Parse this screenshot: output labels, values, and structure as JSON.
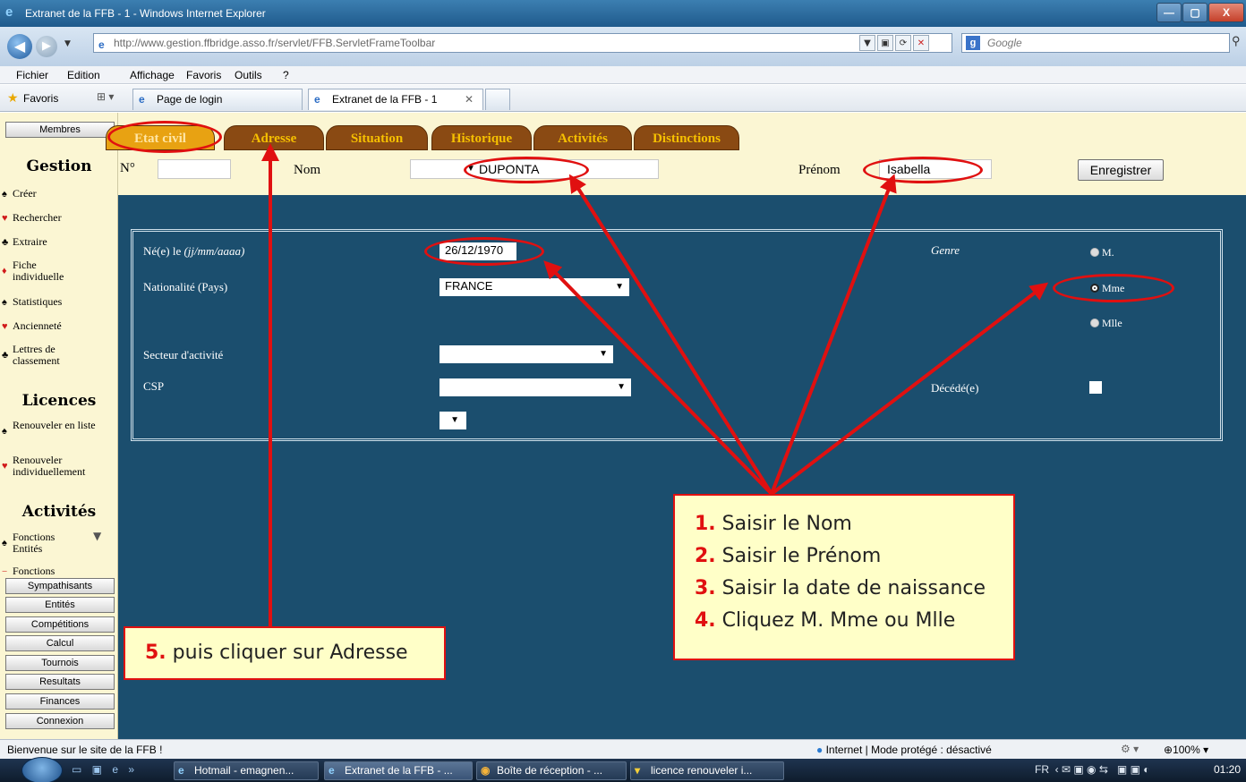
{
  "window": {
    "title": "Extranet de la FFB - 1 - Windows Internet Explorer",
    "url": "http://www.gestion.ffbridge.asso.fr/servlet/FFB.ServletFrameToolbar",
    "search_placeholder": "Google"
  },
  "menu": [
    "Fichier",
    "Edition",
    "Affichage",
    "Favoris",
    "Outils",
    "?"
  ],
  "favorites": {
    "label": "Favoris",
    "tabs": [
      "Page de login",
      "Extranet de la FFB - 1"
    ]
  },
  "sidebar": {
    "membres": "Membres",
    "gestion_title": "Gestion",
    "gestion_items": [
      "Créer",
      "Rechercher",
      "Extraire",
      "Fiche individuelle",
      "Statistiques",
      "Ancienneté",
      "Lettres de classement"
    ],
    "licences_title": "Licences",
    "licences_items": [
      "Renouveler en liste",
      "Renouveler individuellement"
    ],
    "activites_title": "Activités",
    "activites_items": [
      "Fonctions Entités",
      "Fonctions"
    ],
    "buttons": [
      "Sympathisants",
      "Entités",
      "Compétitions",
      "Calcul",
      "Tournois",
      "Resultats",
      "Finances",
      "Connexion"
    ]
  },
  "tabs": [
    "Etat civil",
    "Adresse",
    "Situation",
    "Historique",
    "Activités",
    "Distinctions"
  ],
  "header_form": {
    "num_label": "N°",
    "num_value": "",
    "nom_label": "Nom",
    "nom_value": "DUPONTA",
    "prenom_label": "Prénom",
    "prenom_value": "Isabella",
    "save_button": "Enregistrer"
  },
  "panel": {
    "birth_label": "Né(e) le",
    "birth_format": "(jj/mm/aaaa)",
    "birth_value": "26/12/1970",
    "nationality_label": "Nationalité (Pays)",
    "nationality_value": "FRANCE",
    "sector_label": "Secteur d'activité",
    "csp_label": "CSP",
    "genre_label": "Genre",
    "genre_options": [
      "M.",
      "Mme",
      "Mlle"
    ],
    "genre_selected": "Mme",
    "deceased_label": "Décédé(e)"
  },
  "annotations": {
    "steps": [
      {
        "num": "1.",
        "text": "Saisir le Nom"
      },
      {
        "num": "2.",
        "text": "Saisir le Prénom"
      },
      {
        "num": "3.",
        "text": "Saisir la date de naissance"
      },
      {
        "num": "4.",
        "text": "Cliquez M. Mme ou Mlle"
      }
    ],
    "step5_num": "5.",
    "step5_text": "puis cliquer sur Adresse",
    "color": "#e01010"
  },
  "statusbar": {
    "text": "Bienvenue sur le site de la FFB !",
    "zone": "Internet | Mode protégé : désactivé",
    "zoom": "100%"
  },
  "taskbar": {
    "tasks": [
      "Hotmail - emagnen...",
      "Extranet de la FFB - ...",
      "Boîte de réception - ...",
      "licence renouveler i..."
    ],
    "lang": "FR",
    "clock": "01:20"
  }
}
